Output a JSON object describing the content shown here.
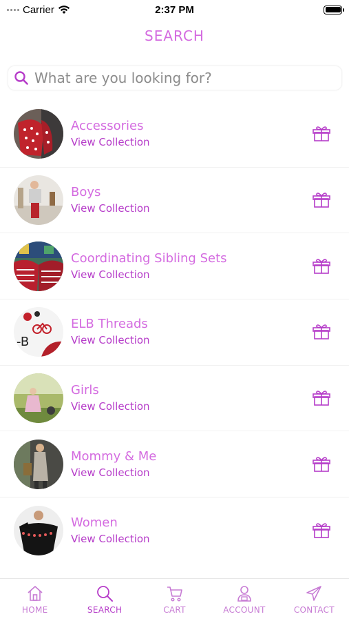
{
  "status_bar": {
    "carrier": "Carrier",
    "time": "2:37 PM",
    "icons": [
      "signal-dots-icon",
      "wifi-icon",
      "battery-icon"
    ]
  },
  "header": {
    "title": "SEARCH"
  },
  "search": {
    "placeholder": "What are you looking for?",
    "value": "",
    "icon": "search-icon"
  },
  "collections": [
    {
      "title": "Accessories",
      "link": "View Collection"
    },
    {
      "title": "Boys",
      "link": "View Collection"
    },
    {
      "title": "Coordinating Sibling Sets",
      "link": "View Collection"
    },
    {
      "title": "ELB Threads",
      "link": "View Collection"
    },
    {
      "title": "Girls",
      "link": "View Collection"
    },
    {
      "title": "Mommy & Me",
      "link": "View Collection"
    },
    {
      "title": "Women",
      "link": "View Collection"
    }
  ],
  "tab_bar": {
    "active": "SEARCH",
    "tabs": [
      {
        "label": "HOME",
        "icon": "home-icon"
      },
      {
        "label": "SEARCH",
        "icon": "search-icon"
      },
      {
        "label": "CART",
        "icon": "cart-icon"
      },
      {
        "label": "ACCOUNT",
        "icon": "account-icon"
      },
      {
        "label": "CONTACT",
        "icon": "send-icon"
      }
    ]
  },
  "colors": {
    "accent": "#d46be0",
    "accent_dark": "#b63dc9",
    "tab_inactive": "#c77bd4"
  }
}
